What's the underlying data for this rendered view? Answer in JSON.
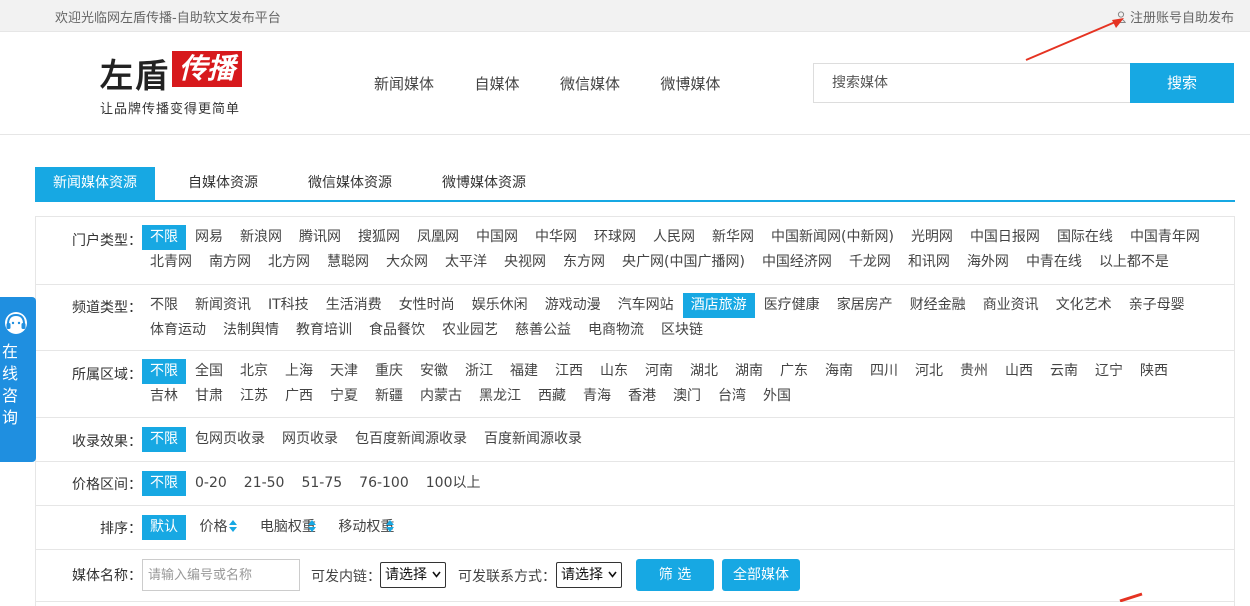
{
  "topbar": {
    "welcome": "欢迎光临网左盾传播-自助软文发布平台",
    "register": "注册账号自助发布",
    "register_icon": "user-icon"
  },
  "logo": {
    "brand_main": "左盾",
    "brand_badge": "传播",
    "slogan": "让品牌传播变得更简单"
  },
  "nav": [
    "新闻媒体",
    "自媒体",
    "微信媒体",
    "微博媒体"
  ],
  "search": {
    "placeholder": "搜索媒体",
    "button": "搜索"
  },
  "tabs": [
    "新闻媒体资源",
    "自媒体资源",
    "微信媒体资源",
    "微博媒体资源"
  ],
  "filters": {
    "portal": {
      "label": "门户类型：",
      "options": [
        "不限",
        "网易",
        "新浪网",
        "腾讯网",
        "搜狐网",
        "凤凰网",
        "中国网",
        "中华网",
        "环球网",
        "人民网",
        "新华网",
        "中国新闻网(中新网)",
        "光明网",
        "中国日报网",
        "国际在线",
        "中国青年网",
        "北青网",
        "南方网",
        "北方网",
        "慧聪网",
        "大众网",
        "太平洋",
        "央视网",
        "东方网",
        "央广网(中国广播网)",
        "中国经济网",
        "千龙网",
        "和讯网",
        "海外网",
        "中青在线",
        "以上都不是"
      ]
    },
    "channel": {
      "label": "频道类型：",
      "options": [
        "不限",
        "新闻资讯",
        "IT科技",
        "生活消费",
        "女性时尚",
        "娱乐休闲",
        "游戏动漫",
        "汽车网站",
        "酒店旅游",
        "医疗健康",
        "家居房产",
        "财经金融",
        "商业资讯",
        "文化艺术",
        "亲子母婴",
        "体育运动",
        "法制舆情",
        "教育培训",
        "食品餐饮",
        "农业园艺",
        "慈善公益",
        "电商物流",
        "区块链"
      ]
    },
    "region": {
      "label": "所属区域：",
      "options": [
        "不限",
        "全国",
        "北京",
        "上海",
        "天津",
        "重庆",
        "安徽",
        "浙江",
        "福建",
        "江西",
        "山东",
        "河南",
        "湖北",
        "湖南",
        "广东",
        "海南",
        "四川",
        "河北",
        "贵州",
        "山西",
        "云南",
        "辽宁",
        "陕西",
        "吉林",
        "甘肃",
        "江苏",
        "广西",
        "宁夏",
        "新疆",
        "内蒙古",
        "黑龙江",
        "西藏",
        "青海",
        "香港",
        "澳门",
        "台湾",
        "外国"
      ]
    },
    "index": {
      "label": "收录效果：",
      "options": [
        "不限",
        "包网页收录",
        "网页收录",
        "包百度新闻源收录",
        "百度新闻源收录"
      ]
    },
    "price": {
      "label": "价格区间：",
      "options": [
        "不限",
        "0-20",
        "21-50",
        "51-75",
        "76-100",
        "100以上"
      ]
    },
    "sort": {
      "label": "排序：",
      "options": [
        "默认",
        "价格",
        "电脑权重",
        "移动权重"
      ]
    },
    "media_name": {
      "label": "媒体名称：",
      "placeholder": "请输入编号或名称",
      "link_label": "可发内链：",
      "link_value": "请选择",
      "contact_label": "可发联系方式：",
      "contact_value": "请选择",
      "filter_button": "筛 选",
      "all_button": "全部媒体"
    }
  },
  "consult": {
    "text": "在线咨询",
    "icon": "headset-icon"
  },
  "colors": {
    "accent": "#17a8e3",
    "brand_red": "#d7191c",
    "annotation": "#e53322"
  }
}
